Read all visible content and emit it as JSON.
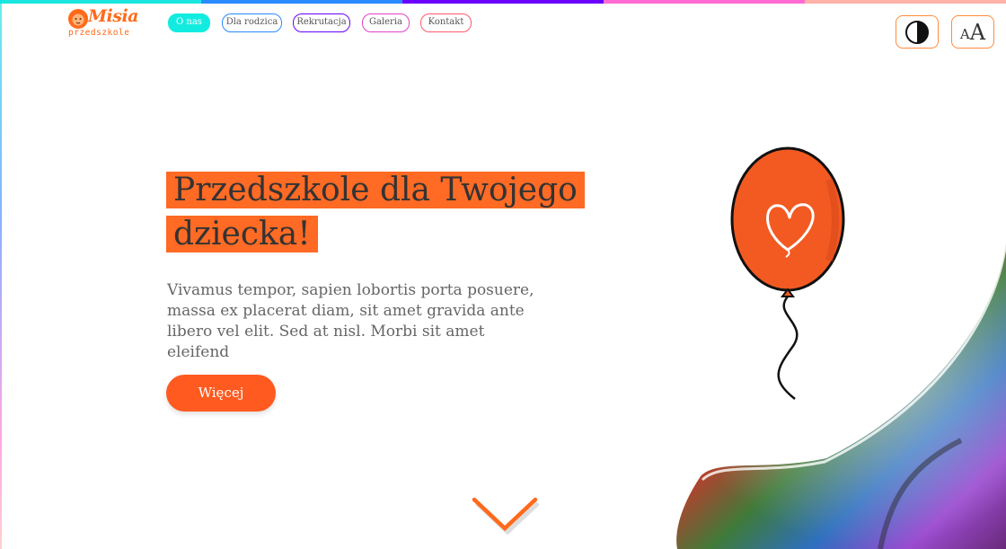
{
  "colors": {
    "accent": "#ff5a1f",
    "stripe": [
      "#19e6df",
      "#2a8bff",
      "#6a00ff",
      "#ff6bd3",
      "#ffb2a8"
    ]
  },
  "logo": {
    "name": "Misia",
    "sub": "przedszkole",
    "icon": "lion-mascot-icon"
  },
  "nav": {
    "items": [
      {
        "label": "O nas",
        "active": true,
        "color": "#12ece0"
      },
      {
        "label": "Dla rodzica",
        "active": false,
        "color": "#2a8bff"
      },
      {
        "label": "Rekrutacja",
        "active": false,
        "color": "#6a00ff"
      },
      {
        "label": "Galeria",
        "active": false,
        "color": "#e040c8"
      },
      {
        "label": "Kontakt",
        "active": false,
        "color": "#ff5a6a"
      }
    ]
  },
  "tools": {
    "contrast_icon": "contrast-icon",
    "font_size_small": "A",
    "font_size_big": "A"
  },
  "hero": {
    "title": "Przedszkole dla Twojego dziecka!",
    "text": "Vivamus tempor, sapien lobortis porta posuere, massa ex placerat diam, sit amet gravida ante libero vel elit. Sed at nisl. Morbi sit amet eleifend",
    "button": "Więcej"
  },
  "decor": {
    "balloon_icon": "heart-balloon-icon",
    "scroll_icon": "chevron-down-icon"
  }
}
